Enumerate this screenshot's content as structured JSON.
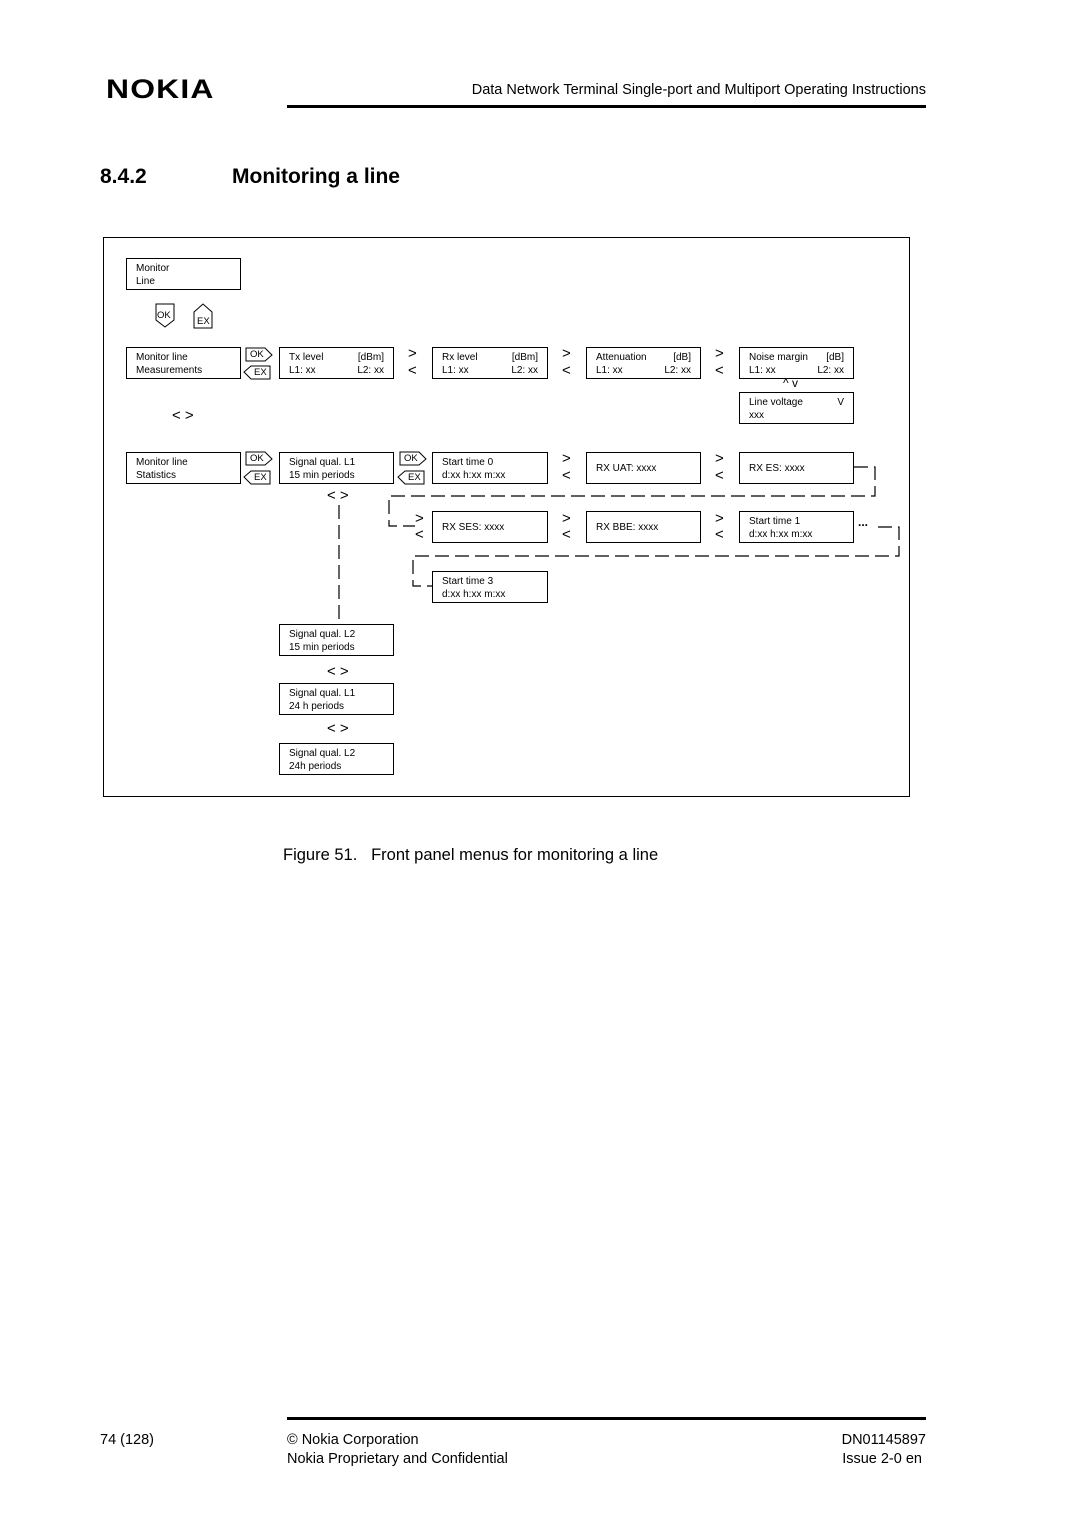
{
  "header": {
    "logo": "NOKIA",
    "doc_title": "Data Network Terminal Single-port and Multiport Operating Instructions"
  },
  "section": {
    "number": "8.4.2",
    "title": "Monitoring a line"
  },
  "diagram": {
    "buttons": {
      "ok": "OK",
      "ex": "EX"
    },
    "boxes": {
      "monitor_line": [
        "Monitor",
        "Line"
      ],
      "measurements": [
        "Monitor line",
        "Measurements"
      ],
      "tx_level": {
        "title": "Tx level",
        "unit": "[dBm]",
        "l1": "L1: xx",
        "l2": "L2: xx"
      },
      "rx_level": {
        "title": "Rx level",
        "unit": "[dBm]",
        "l1": "L1: xx",
        "l2": "L2: xx"
      },
      "attenuation": {
        "title": "Attenuation",
        "unit": "[dB]",
        "l1": "L1: xx",
        "l2": "L2: xx"
      },
      "noise_margin": {
        "title": "Noise margin",
        "unit": "[dB]",
        "l1": "L1: xx",
        "l2": "L2: xx"
      },
      "line_voltage": {
        "title": "Line voltage",
        "unit": "V",
        "value": "xxx"
      },
      "statistics": [
        "Monitor line",
        "Statistics"
      ],
      "sq_l1_15": [
        "Signal qual. L1",
        "15 min periods"
      ],
      "start_time_0": [
        "Start time 0",
        "d:xx h:xx m:xx"
      ],
      "rx_uat": "RX UAT: xxxx",
      "rx_es": "RX ES: xxxx",
      "rx_ses": "RX SES: xxxx",
      "rx_bbe": "RX BBE: xxxx",
      "start_time_1": [
        "Start time 1",
        "d:xx h:xx m:xx"
      ],
      "start_time_3": [
        "Start time 3",
        "d:xx h:xx m:xx"
      ],
      "sq_l2_15": [
        "Signal qual. L2",
        "15 min periods"
      ],
      "sq_l1_24": [
        "Signal qual. L1",
        "24 h periods"
      ],
      "sq_l2_24": [
        "Signal qual. L2",
        "24h periods"
      ]
    },
    "arrows": {
      "right": ">",
      "left": "<",
      "pair": "< >",
      "updown": "^ v",
      "ellipsis": "..."
    }
  },
  "caption": {
    "label": "Figure 51.",
    "text": "Front panel menus for monitoring a line"
  },
  "footer": {
    "page": "74 (128)",
    "copyright": "© Nokia Corporation",
    "confidential": "Nokia Proprietary and Confidential",
    "doc_id": "DN01145897",
    "issue": "Issue 2-0 en"
  }
}
